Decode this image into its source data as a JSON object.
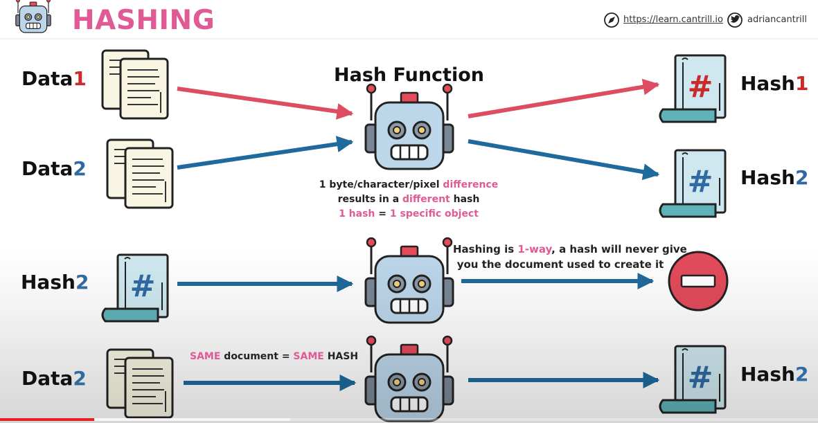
{
  "header": {
    "title": "HASHING",
    "site_link": "https://learn.cantrill.io",
    "twitter_handle": "adriancantrill"
  },
  "top_section": {
    "hash_function_title": "Hash Function",
    "inputs": [
      {
        "prefix": "Data",
        "number": "1"
      },
      {
        "prefix": "Data",
        "number": "2"
      }
    ],
    "outputs": [
      {
        "prefix": "Hash",
        "number": "1"
      },
      {
        "prefix": "Hash",
        "number": "2"
      }
    ],
    "note_line1_a": "1 byte/character/pixel ",
    "note_line1_b": "difference",
    "note_line2_a": "results in a ",
    "note_line2_b": "different",
    "note_line2_c": " hash",
    "note_line3_a": "1 hash",
    "note_line3_b": " = ",
    "note_line3_c": "1 specific object"
  },
  "middle_section": {
    "input": {
      "prefix": "Hash",
      "number": "2"
    },
    "note_line1_a": "Hashing is ",
    "note_line1_b": "1-way",
    "note_line1_c": ", a hash will never give",
    "note_line2": "you the document used to create it"
  },
  "bottom_section": {
    "input": {
      "prefix": "Data",
      "number": "2"
    },
    "output": {
      "prefix": "Hash",
      "number": "2"
    },
    "note_a": "SAME",
    "note_b": " document = ",
    "note_c": "SAME",
    "note_d": " HASH"
  },
  "icons": {
    "logo": "robot-logo-icon",
    "compass": "compass-icon",
    "twitter": "twitter-bird-icon",
    "document": "document-stack-icon",
    "hash_doc": "hash-document-icon",
    "robot": "robot-icon",
    "no_entry": "no-entry-icon"
  },
  "colors": {
    "accent_pink": "#e05a96",
    "red_number": "#c92a2a",
    "blue_number": "#2f6aa3",
    "red_arrow": "#dd4d61",
    "blue_arrow": "#1f6a9c",
    "progress_played": "#e52222"
  },
  "video_progress": 0.115
}
